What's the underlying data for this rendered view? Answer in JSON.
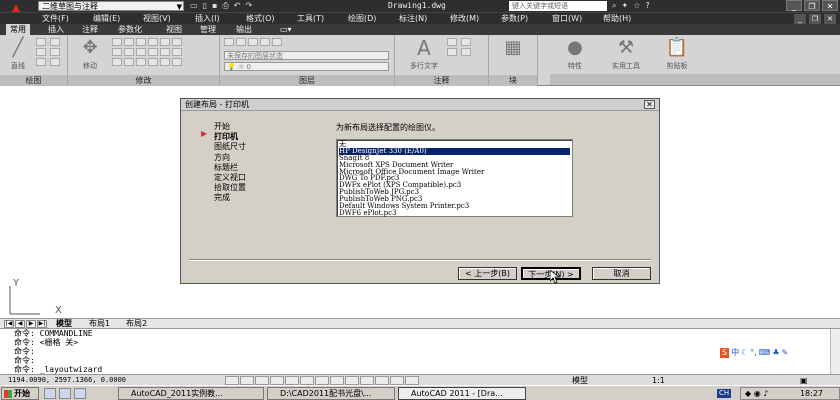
{
  "titlebar": {
    "app_icon": "autocad-a-icon",
    "workspace": "二维草图与注释",
    "document_title": "Drawing1.dwg",
    "search_placeholder": "键入关键字或短语"
  },
  "menubar": {
    "items": [
      "文件(F)",
      "编辑(E)",
      "视图(V)",
      "插入(I)",
      "格式(O)",
      "工具(T)",
      "绘图(D)",
      "标注(N)",
      "修改(M)",
      "参数(P)",
      "窗口(W)",
      "帮助(H)"
    ]
  },
  "ribbon_tabs": {
    "items": [
      "常用",
      "插入",
      "注释",
      "参数化",
      "视图",
      "管理",
      "输出"
    ]
  },
  "ribbon": {
    "draw_group": "绘图",
    "modify_group": "修改",
    "layers_group": "图层",
    "annotation_group": "注释",
    "block_group": "块",
    "line_tool": "直线",
    "move_tool": "移动",
    "layer_state": "未保存的图层状态",
    "layer_current": "0",
    "multiline_text": "多行文字",
    "properties": "特性",
    "utilities": "实用工具",
    "clipboard": "剪贴板"
  },
  "layout_tabs": {
    "items": [
      "模型",
      "布局1",
      "布局2"
    ]
  },
  "command": {
    "lines": [
      "命令: COMMANDLINE",
      "命令: <栅格 关>",
      "命令:",
      "命令:",
      "命令: _layoutwizard"
    ]
  },
  "statusbar": {
    "coordinates": "1194.0090, 2597.1366, 0.0000",
    "model": "模型",
    "scale": "1:1"
  },
  "taskbar": {
    "start": "开始",
    "tasks": [
      "AutoCAD_2011实例教...",
      "D:\\CAD2011配书光盘\\...",
      "AutoCAD 2011 - [Dra..."
    ],
    "ime": "CH",
    "time": "18:27"
  },
  "dialog": {
    "title": "创建布局 - 打印机",
    "steps": [
      "开始",
      "打印机",
      "图纸尺寸",
      "方向",
      "标题栏",
      "定义视口",
      "拾取位置",
      "完成"
    ],
    "current_step": 1,
    "prompt": "为新布局选择配置的绘图仪。",
    "plotters": [
      "无",
      "HP DesignJet 330 (E/A0)",
      "SnagIt 8",
      "Microsoft XPS Document Writer",
      "Microsoft Office Document Image Writer",
      "DWG To PDF.pc3",
      "DWFx ePlot (XPS Compatible).pc3",
      "PublishToWeb JPG.pc3",
      "PublishToWeb PNG.pc3",
      "Default Windows System Printer.pc3",
      "DWF6 ePlot.pc3"
    ],
    "selected_index": 1,
    "back_button": "< 上一步(B)",
    "next_button": "下一步(N) >",
    "cancel_button": "取消"
  }
}
